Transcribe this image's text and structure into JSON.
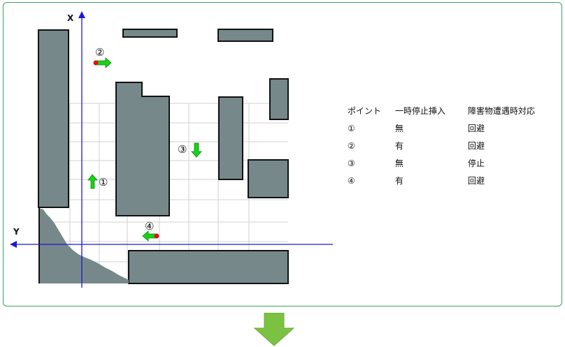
{
  "map": {
    "axis_x_label": "X",
    "axis_y_label": "Y",
    "points": [
      {
        "label": "①",
        "direction": "up"
      },
      {
        "label": "②",
        "direction": "right"
      },
      {
        "label": "③",
        "direction": "down"
      },
      {
        "label": "④",
        "direction": "left"
      }
    ],
    "colors": {
      "obstacle": "#76888a",
      "axis": "#1a1ad6",
      "arrow": "#19d219",
      "robot_dot": "#e01010",
      "grid": "#cfcfcf"
    }
  },
  "table": {
    "headers": [
      "ポイント",
      "一時停止挿入",
      "障害物遭遇時対応"
    ],
    "rows": [
      {
        "point": "①",
        "pause": "無",
        "response": "回避"
      },
      {
        "point": "②",
        "pause": "有",
        "response": "回避"
      },
      {
        "point": "③",
        "pause": "無",
        "response": "停止"
      },
      {
        "point": "④",
        "pause": "有",
        "response": "回避"
      }
    ]
  },
  "flow_arrow": {
    "direction": "down",
    "color": "#7cc242"
  }
}
